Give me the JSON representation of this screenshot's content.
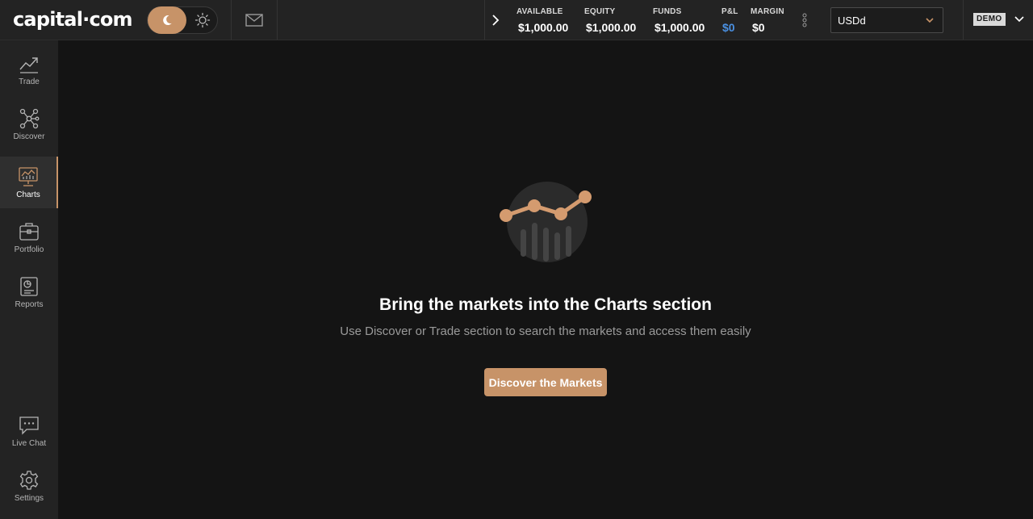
{
  "header": {
    "logo_text": "capital·com",
    "stats": [
      {
        "label": "AVAILABLE",
        "value": "$1,000.00"
      },
      {
        "label": "EQUITY",
        "value": "$1,000.00"
      },
      {
        "label": "FUNDS",
        "value": "$1,000.00"
      },
      {
        "label": "P&L",
        "value": "$0"
      },
      {
        "label": "MARGIN",
        "value": "$0"
      }
    ],
    "account_select": {
      "value": "USDd"
    },
    "mode_badge": "DEMO"
  },
  "sidebar": {
    "items": [
      {
        "label": "Trade",
        "icon": "trend-line-icon"
      },
      {
        "label": "Discover",
        "icon": "network-nodes-icon"
      },
      {
        "label": "Charts",
        "icon": "chart-monitor-icon"
      },
      {
        "label": "Portfolio",
        "icon": "briefcase-icon"
      },
      {
        "label": "Reports",
        "icon": "report-icon"
      },
      {
        "label": "Live Chat",
        "icon": "chat-bubble-icon"
      },
      {
        "label": "Settings",
        "icon": "gear-icon"
      }
    ],
    "active": "Charts"
  },
  "main": {
    "title": "Bring the markets into the Charts section",
    "subtitle": "Use Discover or Trade section to search the markets and access them easily",
    "cta_label": "Discover the Markets"
  },
  "colors": {
    "accent": "#c79368",
    "pnl": "#4a90e2",
    "background": "#141414",
    "panel": "#232323"
  }
}
